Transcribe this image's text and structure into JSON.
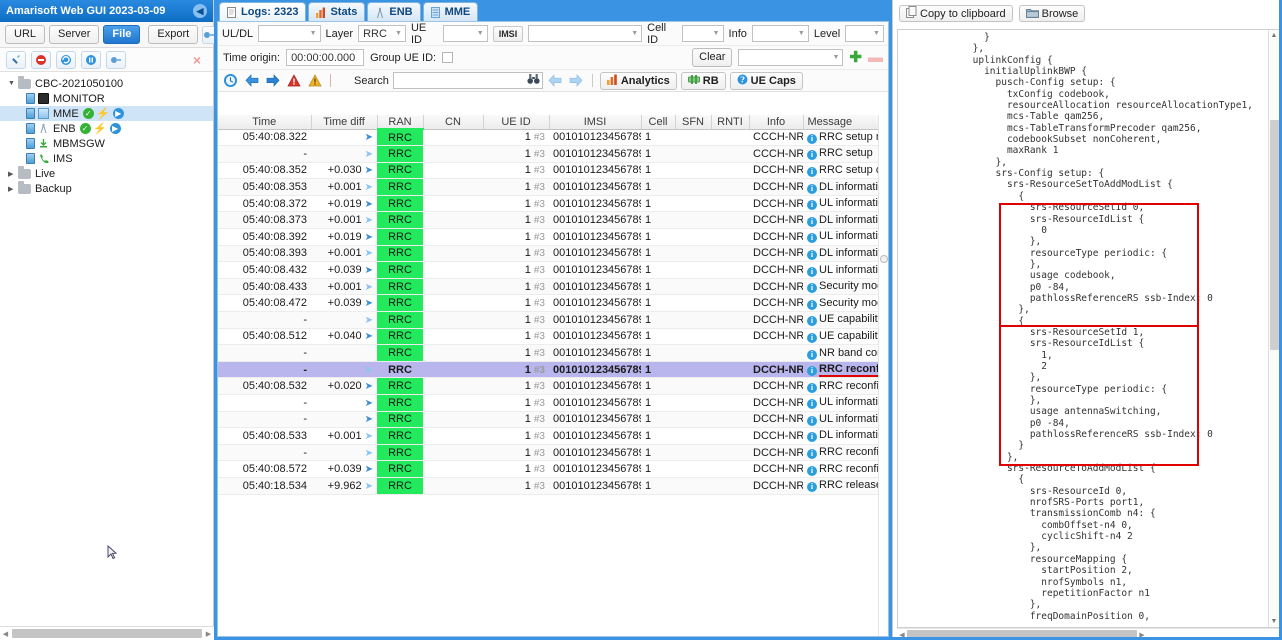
{
  "sidebar": {
    "title": "Amarisoft Web GUI 2023-03-09",
    "collapse_icon": "chevron-left-icon",
    "row1": [
      {
        "label": "URL",
        "active": false
      },
      {
        "label": "Server",
        "active": false
      },
      {
        "label": "File",
        "active": true
      },
      {
        "label": "Export",
        "active": false
      }
    ],
    "row1_extra_icon": "plug-icon",
    "row2_icons": [
      "wrench-icon",
      "stop-icon",
      "refresh-icon",
      "pause-icon",
      "plug-icon"
    ],
    "row2_close": "×",
    "tree": [
      {
        "label": "CBC-2021050100",
        "type": "folder",
        "depth": 0,
        "arrow": "down",
        "selected": false
      },
      {
        "label": "MONITOR",
        "type": "monitor",
        "depth": 1,
        "arrow": "none",
        "selected": false,
        "badges": []
      },
      {
        "label": "MME",
        "type": "mme",
        "depth": 1,
        "arrow": "none",
        "selected": true,
        "badges": [
          "ok",
          "bolt",
          "play"
        ]
      },
      {
        "label": "ENB",
        "type": "enb",
        "depth": 1,
        "arrow": "none",
        "selected": false,
        "badges": [
          "ok",
          "bolt",
          "play"
        ]
      },
      {
        "label": "MBMSGW",
        "type": "mbmsgw",
        "depth": 1,
        "arrow": "none",
        "selected": false,
        "badges": []
      },
      {
        "label": "IMS",
        "type": "ims",
        "depth": 1,
        "arrow": "none",
        "selected": false,
        "badges": []
      },
      {
        "label": "Live",
        "type": "folder",
        "depth": 0,
        "arrow": "right",
        "selected": false
      },
      {
        "label": "Backup",
        "type": "folder",
        "depth": 0,
        "arrow": "right",
        "selected": false
      }
    ]
  },
  "tabs": [
    {
      "label": "Logs: 2323",
      "icon": "document-icon",
      "active": true
    },
    {
      "label": "Stats",
      "icon": "bar-chart-icon",
      "active": false
    },
    {
      "label": "ENB",
      "icon": "tower-icon",
      "active": false
    },
    {
      "label": "MME",
      "icon": "server-icon",
      "active": false
    }
  ],
  "filters": {
    "uldl_label": "UL/DL",
    "uldl_value": "",
    "layer_label": "Layer",
    "layer_value": "RRC",
    "ueid_label": "UE ID",
    "ueid_value": "",
    "imsi_label": "IMSI",
    "imsi_value": "",
    "cellid_label": "Cell ID",
    "cellid_value": "",
    "info_label": "Info",
    "info_value": "",
    "level_label": "Level",
    "level_value": "",
    "time_origin_label": "Time origin:",
    "time_origin_value": "00:00:00.000",
    "group_ueid_label": "Group UE ID:",
    "clear_label": "Clear",
    "preset_value": "",
    "add_icon": "plus-icon",
    "remove_icon": "minus-icon"
  },
  "toolbar": {
    "icons": [
      "clock-icon",
      "arrow-left-blue-icon",
      "arrow-right-blue-icon",
      "error-icon",
      "warning-icon"
    ],
    "search_label": "Search",
    "search_value": "",
    "search_placeholder": "",
    "binoculars_icon": "binoculars-icon",
    "prev_icon": "arrow-left-icon",
    "next_icon": "arrow-right-icon",
    "analytics_label": "Analytics",
    "analytics_icon": "bar-chart-icon",
    "rb_label": "RB",
    "rb_icon": "rb-icon",
    "uecaps_label": "UE Caps",
    "uecaps_icon": "question-icon"
  },
  "table": {
    "columns": [
      "Time",
      "Time diff",
      "RAN",
      "CN",
      "UE ID",
      "IMSI",
      "Cell",
      "SFN",
      "RNTI",
      "Info",
      "Message"
    ],
    "rows": [
      {
        "time": "05:40:08.322",
        "diff": "",
        "arrow": "right",
        "ran": "RRC",
        "cn": "",
        "ueid": "1",
        "ueid_sub": "#3",
        "imsi": "001010123456789",
        "cell": "1",
        "sfn": "",
        "rnti": "",
        "info": "CCCH-NR",
        "msg": "RRC setup request"
      },
      {
        "time": "-",
        "diff": "",
        "arrow": "left",
        "ran": "RRC",
        "cn": "",
        "ueid": "1",
        "ueid_sub": "#3",
        "imsi": "001010123456789",
        "cell": "1",
        "sfn": "",
        "rnti": "",
        "info": "CCCH-NR",
        "msg": "RRC setup"
      },
      {
        "time": "05:40:08.352",
        "diff": "+0.030",
        "arrow": "right",
        "ran": "RRC",
        "cn": "",
        "ueid": "1",
        "ueid_sub": "#3",
        "imsi": "001010123456789",
        "cell": "1",
        "sfn": "",
        "rnti": "",
        "info": "DCCH-NR",
        "msg": "RRC setup complete"
      },
      {
        "time": "05:40:08.353",
        "diff": "+0.001",
        "arrow": "left",
        "ran": "RRC",
        "cn": "",
        "ueid": "1",
        "ueid_sub": "#3",
        "imsi": "001010123456789",
        "cell": "1",
        "sfn": "",
        "rnti": "",
        "info": "DCCH-NR",
        "msg": "DL information transfer"
      },
      {
        "time": "05:40:08.372",
        "diff": "+0.019",
        "arrow": "right",
        "ran": "RRC",
        "cn": "",
        "ueid": "1",
        "ueid_sub": "#3",
        "imsi": "001010123456789",
        "cell": "1",
        "sfn": "",
        "rnti": "",
        "info": "DCCH-NR",
        "msg": "UL information transfer"
      },
      {
        "time": "05:40:08.373",
        "diff": "+0.001",
        "arrow": "left",
        "ran": "RRC",
        "cn": "",
        "ueid": "1",
        "ueid_sub": "#3",
        "imsi": "001010123456789",
        "cell": "1",
        "sfn": "",
        "rnti": "",
        "info": "DCCH-NR",
        "msg": "DL information transfer"
      },
      {
        "time": "05:40:08.392",
        "diff": "+0.019",
        "arrow": "right",
        "ran": "RRC",
        "cn": "",
        "ueid": "1",
        "ueid_sub": "#3",
        "imsi": "001010123456789",
        "cell": "1",
        "sfn": "",
        "rnti": "",
        "info": "DCCH-NR",
        "msg": "UL information transfer"
      },
      {
        "time": "05:40:08.393",
        "diff": "+0.001",
        "arrow": "left",
        "ran": "RRC",
        "cn": "",
        "ueid": "1",
        "ueid_sub": "#3",
        "imsi": "001010123456789",
        "cell": "1",
        "sfn": "",
        "rnti": "",
        "info": "DCCH-NR",
        "msg": "DL information transfer"
      },
      {
        "time": "05:40:08.432",
        "diff": "+0.039",
        "arrow": "right",
        "ran": "RRC",
        "cn": "",
        "ueid": "1",
        "ueid_sub": "#3",
        "imsi": "001010123456789",
        "cell": "1",
        "sfn": "",
        "rnti": "",
        "info": "DCCH-NR",
        "msg": "UL information transfer"
      },
      {
        "time": "05:40:08.433",
        "diff": "+0.001",
        "arrow": "left",
        "ran": "RRC",
        "cn": "",
        "ueid": "1",
        "ueid_sub": "#3",
        "imsi": "001010123456789",
        "cell": "1",
        "sfn": "",
        "rnti": "",
        "info": "DCCH-NR",
        "msg": "Security mode command"
      },
      {
        "time": "05:40:08.472",
        "diff": "+0.039",
        "arrow": "right",
        "ran": "RRC",
        "cn": "",
        "ueid": "1",
        "ueid_sub": "#3",
        "imsi": "001010123456789",
        "cell": "1",
        "sfn": "",
        "rnti": "",
        "info": "DCCH-NR",
        "msg": "Security mode complete"
      },
      {
        "time": "-",
        "diff": "",
        "arrow": "left",
        "ran": "RRC",
        "cn": "",
        "ueid": "1",
        "ueid_sub": "#3",
        "imsi": "001010123456789",
        "cell": "1",
        "sfn": "",
        "rnti": "",
        "info": "DCCH-NR",
        "msg": "UE capability enquiry"
      },
      {
        "time": "05:40:08.512",
        "diff": "+0.040",
        "arrow": "right",
        "ran": "RRC",
        "cn": "",
        "ueid": "1",
        "ueid_sub": "#3",
        "imsi": "001010123456789",
        "cell": "1",
        "sfn": "",
        "rnti": "",
        "info": "DCCH-NR",
        "msg": "UE capability information"
      },
      {
        "time": "-",
        "diff": "",
        "arrow": "none",
        "ran": "RRC",
        "cn": "",
        "ueid": "1",
        "ueid_sub": "#3",
        "imsi": "001010123456789",
        "cell": "1",
        "sfn": "",
        "rnti": "",
        "info": "",
        "msg": "NR band combinations"
      },
      {
        "time": "-",
        "diff": "",
        "arrow": "left",
        "ran": "RRC",
        "cn": "",
        "ueid": "1",
        "ueid_sub": "#3",
        "imsi": "001010123456789",
        "cell": "1",
        "sfn": "",
        "rnti": "",
        "info": "DCCH-NR",
        "msg": "RRC reconfiguration",
        "selected": true,
        "underlined": true
      },
      {
        "time": "05:40:08.532",
        "diff": "+0.020",
        "arrow": "right",
        "ran": "RRC",
        "cn": "",
        "ueid": "1",
        "ueid_sub": "#3",
        "imsi": "001010123456789",
        "cell": "1",
        "sfn": "",
        "rnti": "",
        "info": "DCCH-NR",
        "msg": "RRC reconfiguration complete"
      },
      {
        "time": "-",
        "diff": "",
        "arrow": "right",
        "ran": "RRC",
        "cn": "",
        "ueid": "1",
        "ueid_sub": "#3",
        "imsi": "001010123456789",
        "cell": "1",
        "sfn": "",
        "rnti": "",
        "info": "DCCH-NR",
        "msg": "UL information transfer"
      },
      {
        "time": "-",
        "diff": "",
        "arrow": "right",
        "ran": "RRC",
        "cn": "",
        "ueid": "1",
        "ueid_sub": "#3",
        "imsi": "001010123456789",
        "cell": "1",
        "sfn": "",
        "rnti": "",
        "info": "DCCH-NR",
        "msg": "UL information transfer"
      },
      {
        "time": "05:40:08.533",
        "diff": "+0.001",
        "arrow": "left",
        "ran": "RRC",
        "cn": "",
        "ueid": "1",
        "ueid_sub": "#3",
        "imsi": "001010123456789",
        "cell": "1",
        "sfn": "",
        "rnti": "",
        "info": "DCCH-NR",
        "msg": "DL information transfer"
      },
      {
        "time": "-",
        "diff": "",
        "arrow": "left",
        "ran": "RRC",
        "cn": "",
        "ueid": "1",
        "ueid_sub": "#3",
        "imsi": "001010123456789",
        "cell": "1",
        "sfn": "",
        "rnti": "",
        "info": "DCCH-NR",
        "msg": "RRC reconfiguration"
      },
      {
        "time": "05:40:08.572",
        "diff": "+0.039",
        "arrow": "right",
        "ran": "RRC",
        "cn": "",
        "ueid": "1",
        "ueid_sub": "#3",
        "imsi": "001010123456789",
        "cell": "1",
        "sfn": "",
        "rnti": "",
        "info": "DCCH-NR",
        "msg": "RRC reconfiguration complete"
      },
      {
        "time": "05:40:18.534",
        "diff": "+9.962",
        "arrow": "left",
        "ran": "RRC",
        "cn": "",
        "ueid": "1",
        "ueid_sub": "#3",
        "imsi": "001010123456789",
        "cell": "1",
        "sfn": "",
        "rnti": "",
        "info": "DCCH-NR",
        "msg": "RRC release"
      }
    ]
  },
  "detail": {
    "copy_label": "Copy to clipboard",
    "copy_icon": "clipboard-icon",
    "browse_label": "Browse",
    "browse_icon": "folder-icon",
    "text": "              }\n            },\n            uplinkConfig {\n              initialUplinkBWP {\n                pusch-Config setup: {\n                  txConfig codebook,\n                  resourceAllocation resourceAllocationType1,\n                  mcs-Table qam256,\n                  mcs-TableTransformPrecoder qam256,\n                  codebookSubset nonCoherent,\n                  maxRank 1\n                },\n                srs-Config setup: {\n                  srs-ResourceSetToAddModList {\n                    {\n                      srs-ResourceSetId 0,\n                      srs-ResourceIdList {\n                        0\n                      },\n                      resourceType periodic: {\n                      },\n                      usage codebook,\n                      p0 -84,\n                      pathlossReferenceRS ssb-Index: 0\n                    },\n                    {\n                      srs-ResourceSetId 1,\n                      srs-ResourceIdList {\n                        1,\n                        2\n                      },\n                      resourceType periodic: {\n                      },\n                      usage antennaSwitching,\n                      p0 -84,\n                      pathlossReferenceRS ssb-Index: 0\n                    }\n                  },\n                  srs-ResourceToAddModList {\n                    {\n                      srs-ResourceId 0,\n                      nrofSRS-Ports port1,\n                      transmissionComb n4: {\n                        combOffset-n4 0,\n                        cyclicShift-n4 2\n                      },\n                      resourceMapping {\n                        startPosition 2,\n                        nrofSymbols n1,\n                        repetitionFactor n1\n                      },\n                      freqDomainPosition 0,"
  },
  "annotations": {
    "highlight_color": "#e00000",
    "boxes": [
      {
        "name": "srs-resource-set-0-box"
      },
      {
        "name": "srs-resource-set-1-box"
      }
    ]
  }
}
